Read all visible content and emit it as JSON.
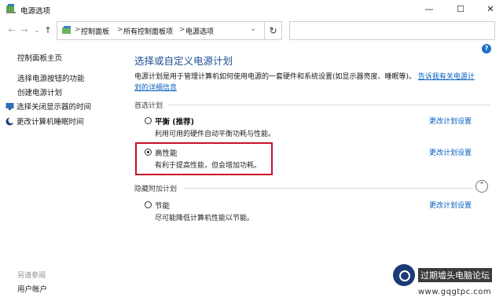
{
  "window": {
    "title": "电源选项",
    "controls": {
      "minimize": "—",
      "maximize": "☐",
      "close": "✕"
    }
  },
  "nav": {
    "back": "←",
    "forward": "→",
    "dropdown": "⌄",
    "up": "↑",
    "breadcrumb_sep": ">",
    "breadcrumb": [
      "控制面板",
      "所有控制面板项",
      "电源选项"
    ],
    "refresh": "↻",
    "search_placeholder": ""
  },
  "sidebar": {
    "home": "控制面板主页",
    "links": [
      "选择电源按钮的功能",
      "创建电源计划",
      "选择关闭显示器的时间",
      "更改计算机睡眠时间"
    ],
    "see_also_label": "另请参阅",
    "see_also_links": [
      "用户帐户"
    ]
  },
  "help": "?",
  "main": {
    "title": "选择或自定义电源计划",
    "description": "电源计划是用于管理计算机如何使用电源的一套硬件和系统设置(如显示器亮度、睡眠等)。",
    "description_link": "告诉我有关电源计划的详细信息",
    "preferred_section": "首选计划",
    "hidden_section": "隐藏附加计划",
    "collapse": "⌃",
    "plans": [
      {
        "name": "平衡 (推荐)",
        "desc": "利用可用的硬件自动平衡功耗与性能。",
        "selected": false,
        "change": "更改计划设置"
      },
      {
        "name": "高性能",
        "desc": "有利于提高性能，但会增加功耗。",
        "selected": true,
        "change": "更改计划设置"
      },
      {
        "name": "节能",
        "desc": "尽可能降低计算机性能以节能。",
        "selected": false,
        "change": "更改计划设置"
      }
    ]
  },
  "watermark": {
    "title": "过期墟头电脑论坛",
    "url": "www.gqgtpc.com"
  },
  "colors": {
    "title_blue": "#1e4f91",
    "link_blue": "#0a5fbf",
    "highlight_red": "#c8102e",
    "help_blue": "#1e6ec8"
  }
}
